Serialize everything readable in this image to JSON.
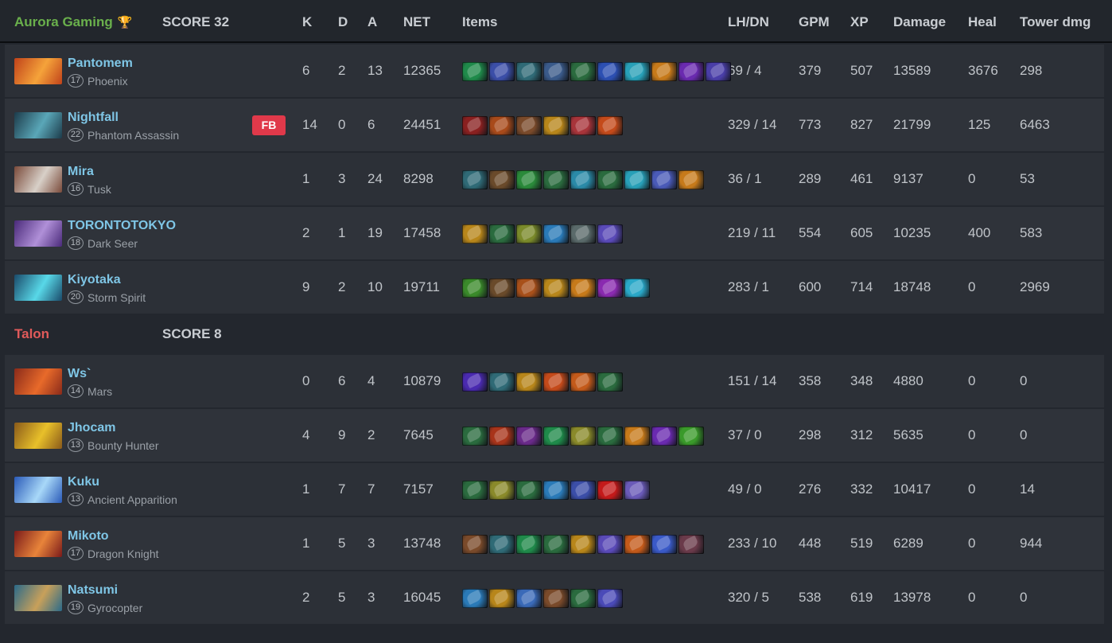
{
  "columns": {
    "k": "K",
    "d": "D",
    "a": "A",
    "net": "NET",
    "items": "Items",
    "lhdn": "LH/DN",
    "gpm": "GPM",
    "xp": "XP",
    "damage": "Damage",
    "heal": "Heal",
    "tower": "Tower dmg"
  },
  "team1": {
    "name": "Aurora Gaming",
    "trophy_icon": "trophy-icon",
    "score": "SCORE 32",
    "name_color": "#6ab04c",
    "players": [
      {
        "name": "Pantomem",
        "level": "17",
        "hero": "Phoenix",
        "fb": "",
        "k": "6",
        "d": "2",
        "a": "13",
        "net": "12365",
        "lhdn": "69 / 4",
        "gpm": "379",
        "xp": "507",
        "damage": "13589",
        "heal": "3676",
        "tower": "298",
        "avatar_colors": [
          "#c0421a",
          "#f5a33a"
        ],
        "items": [
          "#1f8a4a",
          "#3b4ea8",
          "#2f6a76",
          "#3a5a8a",
          "#2a6b3e",
          "#2c4fb2",
          "#28a0b8",
          "#c77a1a",
          "#6a2ab0",
          "#4a3ea8"
        ]
      },
      {
        "name": "Nightfall",
        "level": "22",
        "hero": "Phantom Assassin",
        "fb": "FB",
        "k": "14",
        "d": "0",
        "a": "6",
        "net": "24451",
        "lhdn": "329 / 14",
        "gpm": "773",
        "xp": "827",
        "damage": "21799",
        "heal": "125",
        "tower": "6463",
        "avatar_colors": [
          "#1c3b4a",
          "#5aa7b8"
        ],
        "items": [
          "#8a2020",
          "#a84a1a",
          "#7a4a2a",
          "#b8861a",
          "#a8343a",
          "#c44a1a"
        ]
      },
      {
        "name": "Mira",
        "level": "16",
        "hero": "Tusk",
        "fb": "",
        "k": "1",
        "d": "3",
        "a": "24",
        "net": "8298",
        "lhdn": "36 / 1",
        "gpm": "289",
        "xp": "461",
        "damage": "9137",
        "heal": "0",
        "tower": "53",
        "avatar_colors": [
          "#7a4a3a",
          "#d8d0c8"
        ],
        "items": [
          "#2f6a76",
          "#6a4a2a",
          "#2a8a3a",
          "#2a6b3e",
          "#2a8aa8",
          "#2a6b3e",
          "#28a0b8",
          "#4a5ab8",
          "#c77a1a"
        ]
      },
      {
        "name": "TORONTOTOKYO",
        "level": "18",
        "hero": "Dark Seer",
        "fb": "",
        "k": "2",
        "d": "1",
        "a": "19",
        "net": "17458",
        "lhdn": "219 / 11",
        "gpm": "554",
        "xp": "605",
        "damage": "10235",
        "heal": "400",
        "tower": "583",
        "avatar_colors": [
          "#4a2a7a",
          "#b090d8"
        ],
        "items": [
          "#b8861a",
          "#2a6b3e",
          "#7a8a2a",
          "#2a7ab8",
          "#5a6a6a",
          "#5a4ab8"
        ]
      },
      {
        "name": "Kiyotaka",
        "level": "20",
        "hero": "Storm Spirit",
        "fb": "",
        "k": "9",
        "d": "2",
        "a": "10",
        "net": "19711",
        "lhdn": "283 / 1",
        "gpm": "600",
        "xp": "714",
        "damage": "18748",
        "heal": "0",
        "tower": "2969",
        "avatar_colors": [
          "#1a4a6a",
          "#58d8e8"
        ],
        "items": [
          "#3a8a2a",
          "#6a4a2a",
          "#a8501a",
          "#b8861a",
          "#c77a1a",
          "#8a2ab0",
          "#2aa8c8"
        ]
      }
    ]
  },
  "team2": {
    "name": "Talon",
    "score": "SCORE 8",
    "name_color": "#e05a5a",
    "players": [
      {
        "name": "Ws`",
        "level": "14",
        "hero": "Mars",
        "fb": "",
        "k": "0",
        "d": "6",
        "a": "4",
        "net": "10879",
        "lhdn": "151 / 14",
        "gpm": "358",
        "xp": "348",
        "damage": "4880",
        "heal": "0",
        "tower": "0",
        "avatar_colors": [
          "#8a2a1a",
          "#e86a2a"
        ],
        "items": [
          "#4a2ab0",
          "#2f6a76",
          "#b8861a",
          "#c44a1a",
          "#c45a1a",
          "#2a6b3e"
        ]
      },
      {
        "name": "Jhocam",
        "level": "13",
        "hero": "Bounty Hunter",
        "fb": "",
        "k": "4",
        "d": "9",
        "a": "2",
        "net": "7645",
        "lhdn": "37 / 0",
        "gpm": "298",
        "xp": "312",
        "damage": "5635",
        "heal": "0",
        "tower": "0",
        "avatar_colors": [
          "#8a5a1a",
          "#e8c02a"
        ],
        "items": [
          "#2a6b3e",
          "#a8341a",
          "#6a2a8a",
          "#1f8a4a",
          "#8a8a2a",
          "#2a6b3e",
          "#c77a1a",
          "#6a2ab0",
          "#3a9a2a"
        ]
      },
      {
        "name": "Kuku",
        "level": "13",
        "hero": "Ancient Apparition",
        "fb": "",
        "k": "1",
        "d": "7",
        "a": "7",
        "net": "7157",
        "lhdn": "49 / 0",
        "gpm": "276",
        "xp": "332",
        "damage": "10417",
        "heal": "0",
        "tower": "14",
        "avatar_colors": [
          "#2a5ab8",
          "#a8d8f8"
        ],
        "items": [
          "#2a6b3e",
          "#8a8a2a",
          "#2a6b3e",
          "#2a7ab8",
          "#3b4ea8",
          "#c41a1a",
          "#6a5ab8"
        ]
      },
      {
        "name": "Mikoto",
        "level": "17",
        "hero": "Dragon Knight",
        "fb": "",
        "k": "1",
        "d": "5",
        "a": "3",
        "net": "13748",
        "lhdn": "233 / 10",
        "gpm": "448",
        "xp": "519",
        "damage": "6289",
        "heal": "0",
        "tower": "944",
        "avatar_colors": [
          "#7a1a1a",
          "#e8843a"
        ],
        "items": [
          "#7a4a2a",
          "#2f6a76",
          "#1f8a4a",
          "#2a6b3e",
          "#b8861a",
          "#5a4ab8",
          "#c45a1a",
          "#3a5ac8",
          "#6a3a4a"
        ]
      },
      {
        "name": "Natsumi",
        "level": "19",
        "hero": "Gyrocopter",
        "fb": "",
        "k": "2",
        "d": "5",
        "a": "3",
        "net": "16045",
        "lhdn": "320 / 5",
        "gpm": "538",
        "xp": "619",
        "damage": "13978",
        "heal": "0",
        "tower": "0",
        "avatar_colors": [
          "#2a6a8a",
          "#c8a05a"
        ],
        "items": [
          "#2a7ab8",
          "#b8861a",
          "#3a6ab8",
          "#7a4a2a",
          "#2a6b3e",
          "#4a4ab8"
        ]
      }
    ]
  }
}
